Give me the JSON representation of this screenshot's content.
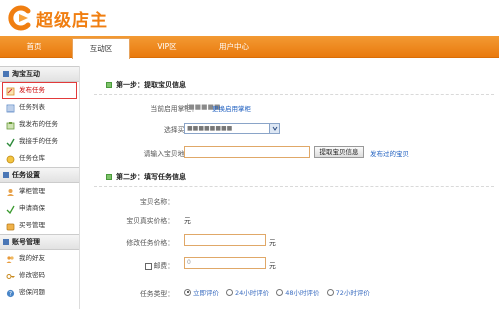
{
  "brand": {
    "title": "超级店主"
  },
  "nav": {
    "items": [
      {
        "label": "首页"
      },
      {
        "label": "互动区"
      },
      {
        "label": "VIP区"
      },
      {
        "label": "用户中心"
      }
    ],
    "active": "互动区"
  },
  "sidebar": {
    "sections": [
      {
        "title": "淘宝互动",
        "items": [
          {
            "label": "发布任务",
            "icon": "publish-icon"
          },
          {
            "label": "任务列表",
            "icon": "list-icon"
          },
          {
            "label": "我发布的任务",
            "icon": "my-published-icon"
          },
          {
            "label": "我接手的任务",
            "icon": "my-accepted-icon"
          },
          {
            "label": "任务仓库",
            "icon": "warehouse-icon"
          }
        ]
      },
      {
        "title": "任务设置",
        "items": [
          {
            "label": "掌柜管理",
            "icon": "shopkeeper-icon"
          },
          {
            "label": "申请商保",
            "icon": "apply-icon"
          },
          {
            "label": "买号管理",
            "icon": "buyer-account-icon"
          }
        ]
      },
      {
        "title": "账号管理",
        "items": [
          {
            "label": "我的好友",
            "icon": "friends-icon"
          },
          {
            "label": "修改密码",
            "icon": "password-icon"
          },
          {
            "label": "密保问题",
            "icon": "security-question-icon"
          }
        ]
      }
    ]
  },
  "step1": {
    "title": "第一步：提取宝贝信息",
    "current_shopkeeper_label": "当前启用掌柜：",
    "current_shopkeeper_value": "d■■■■■",
    "change_link": "更换启用掌柜",
    "choose_buyer_label": "选择买号：",
    "choose_buyer_value": "■■■■■■■■",
    "url_label": "请输入宝贝地址：",
    "url_value": "",
    "extract_button": "提取宝贝信息",
    "published_link": "发布过的宝贝"
  },
  "step2": {
    "title": "第二步：填写任务信息",
    "name_label": "宝贝名称：",
    "name_value": "",
    "price_label": "宝贝真实价格：",
    "price_unit": "元",
    "edit_price_label": "修改任务价格：",
    "edit_price_value": "",
    "edit_price_unit": "元",
    "postage_label": "邮费：",
    "postage_value": "0",
    "postage_unit": "元",
    "task_type_label": "任务类型：",
    "task_types": [
      {
        "label": "立即评价",
        "checked": true
      },
      {
        "label": "24小时评价",
        "checked": false
      },
      {
        "label": "48小时评价",
        "checked": false
      },
      {
        "label": "72小时评价",
        "checked": false
      }
    ]
  }
}
